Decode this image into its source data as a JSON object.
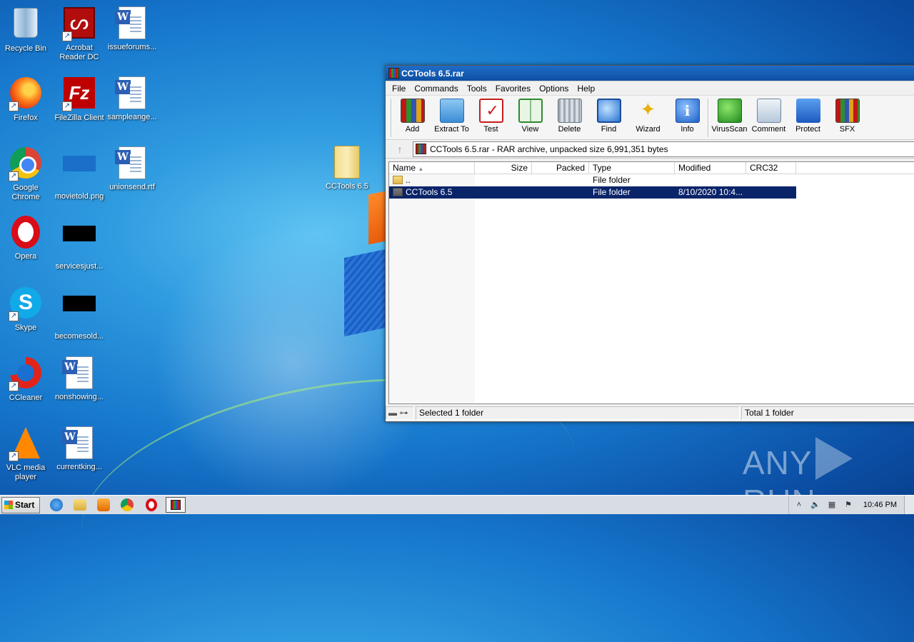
{
  "desktop": {
    "icons_col1": [
      {
        "label": "Recycle Bin"
      },
      {
        "label": "Firefox"
      },
      {
        "label": "Google Chrome"
      },
      {
        "label": "Opera"
      },
      {
        "label": "Skype"
      },
      {
        "label": "CCleaner"
      },
      {
        "label": "VLC media player"
      }
    ],
    "icons_col2": [
      {
        "label": "Acrobat Reader DC"
      },
      {
        "label": "FileZilla Client"
      },
      {
        "label": "movietold.png"
      },
      {
        "label": "servicesjust..."
      },
      {
        "label": "becomesold..."
      },
      {
        "label": "nonshowing..."
      },
      {
        "label": "currentking..."
      }
    ],
    "icons_col3": [
      {
        "label": "issueforums..."
      },
      {
        "label": "sampleange..."
      },
      {
        "label": "unionsend.rtf"
      }
    ],
    "folder_icon": {
      "label": "CCTools 6.5"
    },
    "watermark": {
      "left": "ANY",
      "right": "RUN"
    }
  },
  "window": {
    "title": "CCTools 6.5.rar",
    "menu": [
      "File",
      "Commands",
      "Tools",
      "Favorites",
      "Options",
      "Help"
    ],
    "toolbar": [
      "Add",
      "Extract To",
      "Test",
      "View",
      "Delete",
      "Find",
      "Wizard",
      "Info",
      "VirusScan",
      "Comment",
      "Protect",
      "SFX"
    ],
    "path": "CCTools 6.5.rar - RAR archive, unpacked size 6,991,351 bytes",
    "columns": [
      "Name",
      "Size",
      "Packed",
      "Type",
      "Modified",
      "CRC32"
    ],
    "sort_indicator": "▲",
    "rows": [
      {
        "name": "..",
        "size": "",
        "packed": "",
        "type": "File folder",
        "modified": "",
        "crc": ""
      },
      {
        "name": "CCTools 6.5",
        "size": "",
        "packed": "",
        "type": "File folder",
        "modified": "8/10/2020 10:4...",
        "crc": ""
      }
    ],
    "status": {
      "selected": "Selected 1 folder",
      "total": "Total 1 folder"
    }
  },
  "taskbar": {
    "start_label": "Start",
    "clock": "10:46 PM"
  },
  "colors": {
    "selection": "#0a246a",
    "titlebar": "#1f6cc7"
  }
}
